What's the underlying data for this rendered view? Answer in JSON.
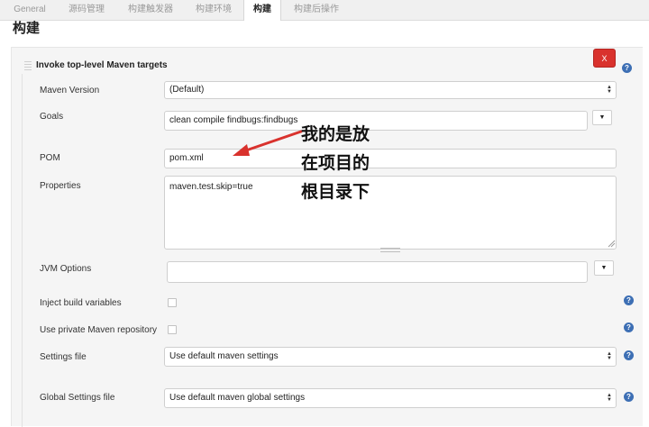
{
  "tabs": [
    {
      "label": "General"
    },
    {
      "label": "源码管理"
    },
    {
      "label": "构建触发器"
    },
    {
      "label": "构建环境"
    },
    {
      "label": "构建"
    },
    {
      "label": "构建后操作"
    }
  ],
  "section_title": "构建",
  "step": {
    "title": "Invoke top-level Maven targets",
    "delete_label": "X",
    "help_glyph": "?"
  },
  "form": {
    "maven_version": {
      "label": "Maven Version",
      "value": "(Default)"
    },
    "goals": {
      "label": "Goals",
      "value": "clean compile findbugs:findbugs"
    },
    "pom": {
      "label": "POM",
      "value": "pom.xml"
    },
    "properties": {
      "label": "Properties",
      "value": "maven.test.skip=true"
    },
    "jvm_options": {
      "label": "JVM Options",
      "value": ""
    },
    "inject_build_variables": {
      "label": "Inject build variables",
      "checked": false
    },
    "private_repo": {
      "label": "Use private Maven repository",
      "checked": false
    },
    "settings_file": {
      "label": "Settings file",
      "value": "Use default maven settings"
    },
    "global_settings_file": {
      "label": "Global Settings file",
      "value": "Use default maven global settings"
    }
  },
  "annotation": {
    "lines": [
      "我的是放",
      "在项目的",
      "根目录下"
    ],
    "color": "#d9322d"
  },
  "colors": {
    "delete_button": "#d9322d",
    "help_icon": "#3d6fb4"
  },
  "icons": {
    "expand": "▼",
    "select_arrows": "▲▼"
  }
}
